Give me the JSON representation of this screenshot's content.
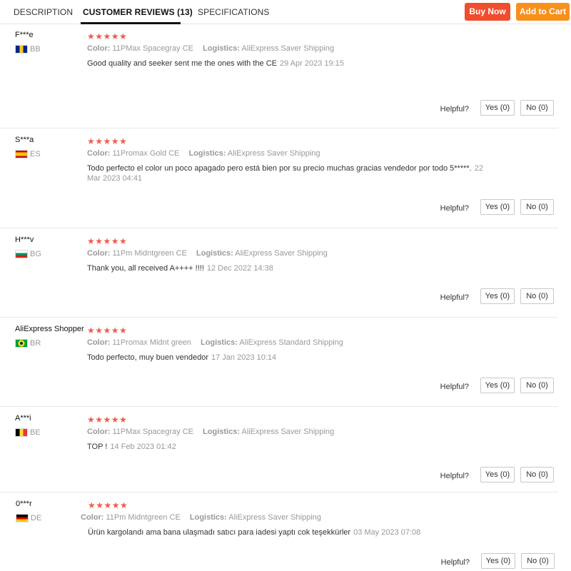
{
  "tabs": {
    "description": "DESCRIPTION",
    "reviews": "CUSTOMER REVIEWS (13)",
    "specifications": "SPECIFICATIONS"
  },
  "actions": {
    "buy_now": "Buy Now",
    "add_to_cart": "Add to Cart"
  },
  "labels": {
    "color": "Color:",
    "logistics": "Logistics:",
    "helpful": "Helpful?",
    "yes": "Yes (0)",
    "no": "No (0)"
  },
  "colors": {
    "star": "#f05b4c",
    "buy_now_bg": "#f04d2c",
    "add_to_cart_bg": "#f8901c"
  },
  "reviews": [
    {
      "name": "F***e",
      "country": "BB",
      "flag_icon": "barbados-flag-icon",
      "stars": "★★★★★",
      "rating": 5,
      "color": "11PMax Spacegray CE",
      "logistics": "AliExpress Saver Shipping",
      "text": "Good quality and seeker sent me the ones with the CE",
      "date": "29 Apr 2023 19:15"
    },
    {
      "name": "S***a",
      "country": "ES",
      "flag_icon": "spain-flag-icon",
      "stars": "★★★★★",
      "rating": 5,
      "color": "11Promax Gold CE",
      "logistics": "AliExpress Saver Shipping",
      "text": "Todo perfecto el color un poco apagado pero está bien por su precio muchas gracias vendedor por todo 5*****.",
      "date": "22 Mar 2023 04:41"
    },
    {
      "name": "H***v",
      "country": "BG",
      "flag_icon": "bulgaria-flag-icon",
      "stars": "★★★★★",
      "rating": 5,
      "color": "11Pm Midntgreen CE",
      "logistics": "AliExpress Saver Shipping",
      "text": "Thank you, all received A++++ !!!!",
      "date": "12 Dec 2022 14:38"
    },
    {
      "name": "AliExpress Shopper",
      "country": "BR",
      "flag_icon": "brazil-flag-icon",
      "stars": "★★★★★",
      "rating": 5,
      "color": "11Promax Midnt green",
      "logistics": "AliExpress Standard Shipping",
      "text": "Todo perfecto, muy buen vendedor",
      "date": "17 Jan 2023 10:14"
    },
    {
      "name": "A***i",
      "country": "BE",
      "flag_icon": "belgium-flag-icon",
      "stars": "★★★★★",
      "rating": 5,
      "color": "11PMax Spacegray CE",
      "logistics": "AliExpress Saver Shipping",
      "text": "TOP !",
      "date": "14 Feb 2023 01:42"
    },
    {
      "name": "0***r",
      "country": "DE",
      "flag_icon": "germany-flag-icon",
      "stars": "★★★★★",
      "rating": 5,
      "color": "11Pm Midntgreen CE",
      "logistics": "AliExpress Saver Shipping",
      "text": "Ürün kargolandı ama bana ulaşmadı satıcı para iadesi yaptı cok teşekkürler",
      "date": "03 May 2023 07:08"
    }
  ]
}
